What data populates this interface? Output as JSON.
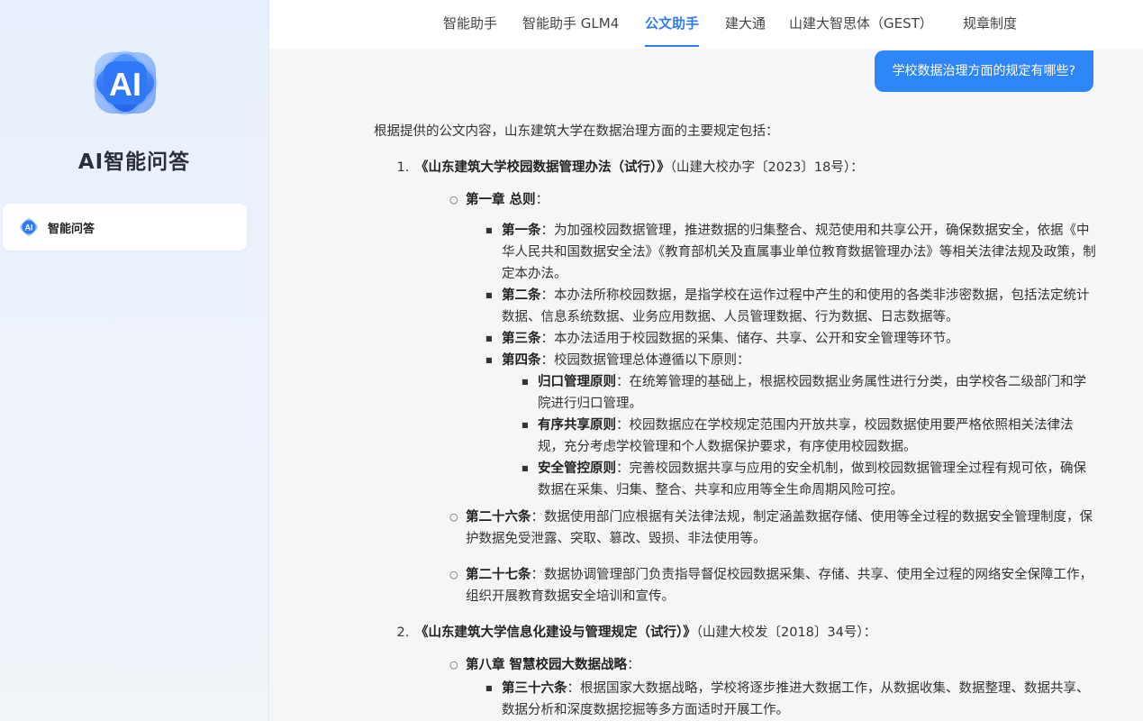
{
  "sidebar": {
    "logo_text": "AI",
    "brand_title": "AI智能问答",
    "nav_items": [
      {
        "label": "智能问答",
        "icon": "ai-icon",
        "active": true
      }
    ]
  },
  "topnav": {
    "tabs": [
      {
        "label": "智能助手"
      },
      {
        "label": "智能助手 GLM4"
      },
      {
        "label": "公文助手"
      },
      {
        "label": "建大通"
      },
      {
        "label": "山建大智思体（GEST）"
      },
      {
        "label": "规章制度"
      }
    ],
    "active_tab": "公文助手"
  },
  "conversation": {
    "user_question": "学校数据治理方面的规定有哪些?",
    "intro": "根据提供的公文内容，山东建筑大学在数据治理方面的主要规定包括：",
    "docs": [
      {
        "title": "《山东建筑大学校园数据管理办法（试行）》",
        "ref": "（山建大校办字〔2023〕18号）：",
        "chapter1": {
          "label": "第一章 总则",
          "suffix": "：",
          "articles": [
            {
              "label": "第一条",
              "text": "：为加强校园数据管理，推进数据的归集整合、规范使用和共享公开，确保数据安全，依据《中华人民共和国数据安全法》《教育部机关及直属事业单位教育数据管理办法》等相关法律法规及政策，制定本办法。"
            },
            {
              "label": "第二条",
              "text": "：本办法所称校园数据，是指学校在运作过程中产生的和使用的各类非涉密数据，包括法定统计数据、信息系统数据、业务应用数据、人员管理数据、行为数据、日志数据等。"
            },
            {
              "label": "第三条",
              "text": "：本办法适用于校园数据的采集、储存、共享、公开和安全管理等环节。"
            },
            {
              "label": "第四条",
              "text": "：校园数据管理总体遵循以下原则："
            }
          ],
          "principles": [
            {
              "label": "归口管理原则",
              "text": "：在统筹管理的基础上，根据校园数据业务属性进行分类，由学校各二级部门和学院进行归口管理。"
            },
            {
              "label": "有序共享原则",
              "text": "：校园数据应在学校规定范围内开放共享，校园数据使用要严格依照相关法律法规，充分考虑学校管理和个人数据保护要求，有序使用校园数据。"
            },
            {
              "label": "安全管控原则",
              "text": "：完善校园数据共享与应用的安全机制，做到校园数据管理全过程有规可依，确保数据在采集、归集、整合、共享和应用等全生命周期风险可控。"
            }
          ]
        },
        "art26": {
          "label": "第二十六条",
          "text": "：数据使用部门应根据有关法律法规，制定涵盖数据存储、使用等全过程的数据安全管理制度，保护数据免受泄露、突取、篡改、毁损、非法使用等。"
        },
        "art27": {
          "label": "第二十七条",
          "text": "：数据协调管理部门负责指导督促校园数据采集、存储、共享、使用全过程的网络安全保障工作，组织开展教育数据安全培训和宣传。"
        }
      },
      {
        "title": "《山东建筑大学信息化建设与管理规定（试行）》",
        "ref": "（山建大校发〔2018〕34号）：",
        "chapter8": {
          "label": "第八章 智慧校园大数据战略",
          "suffix": "：",
          "art36": {
            "label": "第三十六条",
            "text": "：根据国家大数据战略，学校将逐步推进大数据工作，从数据收集、数据整理、数据共享、数据分析和深度数据挖掘等多方面适时开展工作。"
          }
        }
      }
    ]
  },
  "colors": {
    "accent": "#2f7cf6",
    "bubble": "#2f86f6",
    "sidebar_bg": "#e7effc",
    "main_bg": "#f5f6f8"
  }
}
